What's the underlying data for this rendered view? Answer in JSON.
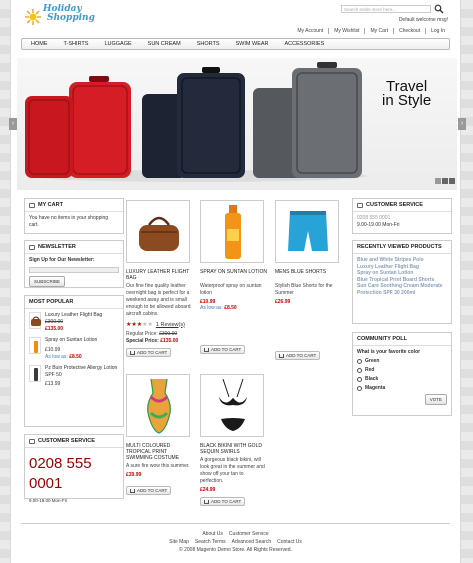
{
  "header": {
    "logo_line1": "Holiday",
    "logo_line2": "Shopping",
    "search_placeholder": "Search entire store here...",
    "welcome": "Default welcome msg!",
    "links": [
      "My Account",
      "My Wishlist",
      "My Cart",
      "Checkout",
      "Log In"
    ]
  },
  "nav": [
    "HOME",
    "T-SHIRTS",
    "LUGGAGE",
    "SUN CREAM",
    "SHORTS",
    "SWIM WEAR",
    "ACCESSORIES"
  ],
  "banner": {
    "slogan_line1": "Travel",
    "slogan_line2": "in Style",
    "prev": "‹",
    "next": "›"
  },
  "cart": {
    "title": "MY CART",
    "text": "You have no items in your shopping cart."
  },
  "newsletter": {
    "title": "NEWSLETTER",
    "label": "Sign Up for Our Newsletter:",
    "button": "SUBSCRIBE"
  },
  "popular": {
    "title": "MOST POPULAR",
    "items": [
      {
        "name": "Luxury Leather Flight Bag",
        "old": "£300.00",
        "price": "£135.00"
      },
      {
        "name": "Spray on Suntan Lotion",
        "price": "£10.99",
        "as_low": "As low as:",
        "low": "£8.50"
      },
      {
        "name": "Pz Buin Protective Allergy Lotion SPF 50",
        "price": "£13.99"
      }
    ]
  },
  "customer_left": {
    "title": "CUSTOMER SERVICE",
    "phone": "0208 555 0001",
    "hours": "9.00-19.00 Mon-Fri"
  },
  "products": [
    {
      "name": "LUXURY LEATHER FLIGHT BAG",
      "desc": "Our fine fine quality leather overnight bag is perfect for a weekend away and is small enough to be allowed aboard aircraft cabins.",
      "reviews": "1 Review(s)",
      "regular": "Regular Price:",
      "regular_price": "£300.00",
      "special": "Special Price:",
      "special_price": "£135.00",
      "button": "ADD TO CART"
    },
    {
      "name": "SPRAY ON SUNTAN LOTION",
      "desc": "Waterproof spray on suntan lotion",
      "price": "£10.99",
      "as_low": "As low as:",
      "low": "£8.50",
      "button": "ADD TO CART"
    },
    {
      "name": "MENS BLUE SHORTS",
      "desc": "Stylish Blue Shorts for the Summer",
      "price": "£26.99",
      "button": "ADD TO CART"
    },
    {
      "name": "MULTI COLOURED TROPICAL PRINT SWIMMING COSTUME",
      "desc": "A sure fire wow this summer.",
      "price": "£39.99",
      "button": "ADD TO CART"
    },
    {
      "name": "BLACK BIKINI WITH GOLD SEQUIN SWIRLS",
      "desc": "A gorgeous black bikini, will look great in the summer and show off your tan to perfection.",
      "price": "£24.99",
      "button": "ADD TO CART"
    }
  ],
  "customer_right": {
    "title": "CUSTOMER SERVICE",
    "phone": "0208 555 0001",
    "hours": "9.00-19.00 Mon-Fri"
  },
  "recent": {
    "title": "RECENTLY VIEWED PRODUCTS",
    "items": [
      "Blue and White Stripes Polo",
      "Luxury Leather Flight Bag",
      "Spray on Suntan Lotion",
      "Blue Tropical Print Board Shorts",
      "Sun Care Soothing Cream Moderate Protection SPF 30 200ml"
    ]
  },
  "poll": {
    "title": "COMMUNITY POLL",
    "question": "What is your favorite color",
    "options": [
      "Green",
      "Red",
      "Black",
      "Magenta"
    ],
    "button": "VOTE"
  },
  "footer": {
    "row1": [
      "About Us",
      "Customer Service"
    ],
    "row2": [
      "Site Map",
      "Search Terms",
      "Advanced Search",
      "Contact Us"
    ],
    "copyright": "© 2008 Magento Demo Store. All Rights Reserved."
  }
}
